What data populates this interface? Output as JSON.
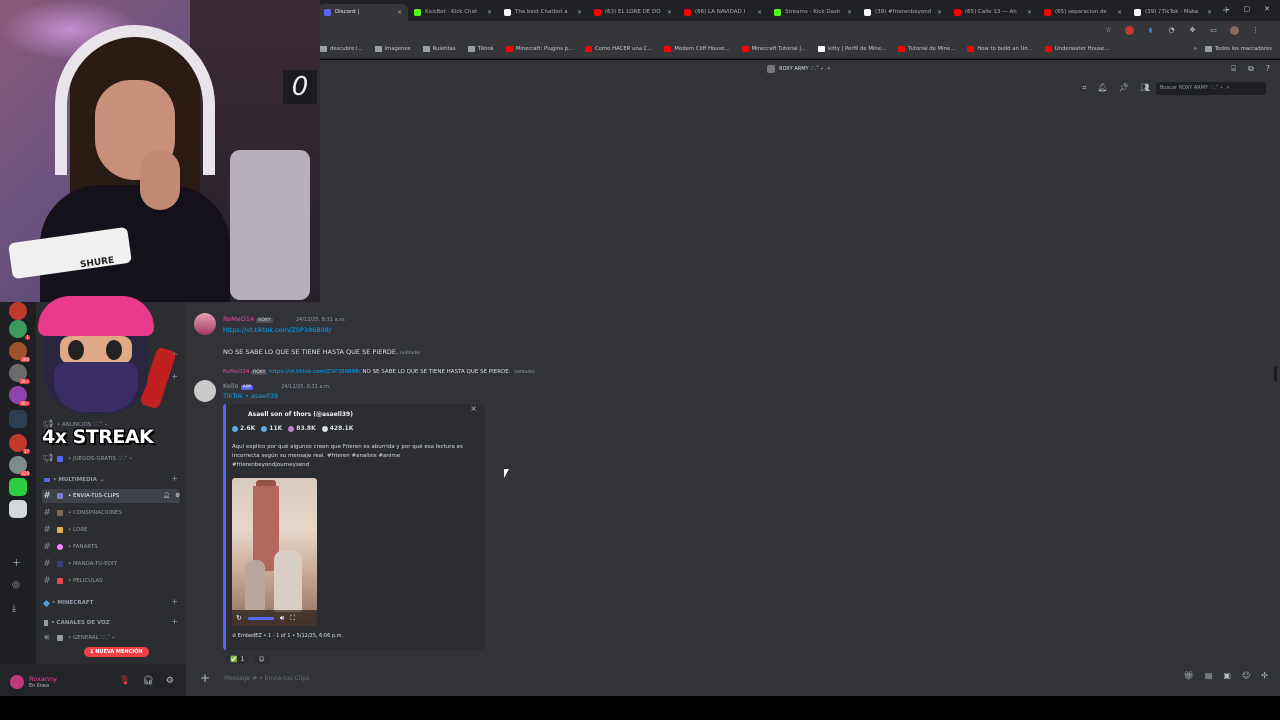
{
  "browser": {
    "tabs": [
      {
        "title": "Discord |",
        "color": "#5865f2"
      },
      {
        "title": "KickBot - Kick Chat",
        "color": "#53fc18"
      },
      {
        "title": "The best Chatbot a",
        "color": "#ffffff"
      },
      {
        "title": "(63) EL LORE DE DO",
        "color": "#ff0000"
      },
      {
        "title": "(66) LA NAVIDAD I",
        "color": "#ff0000"
      },
      {
        "title": "Streams - Kick Dash",
        "color": "#53fc18"
      },
      {
        "title": "(39) #frierenbeyond",
        "color": "#ffffff"
      },
      {
        "title": "(65) Calle 13 — Ah",
        "color": "#ff0000"
      },
      {
        "title": "(65) separacion de",
        "color": "#ff0000"
      },
      {
        "title": "(39) ♪TikTok - Make",
        "color": "#ffffff"
      }
    ],
    "bookmarks": [
      {
        "label": "descubre l...",
        "color": "#9aa0a6"
      },
      {
        "label": "Imagenes",
        "color": "#9aa0a6"
      },
      {
        "label": "Ruletitas",
        "color": "#9aa0a6"
      },
      {
        "label": "Tiktok",
        "color": "#9aa0a6"
      },
      {
        "label": "Minecraft: Plugins p...",
        "color": "#ff0000"
      },
      {
        "label": "Como HACER una C...",
        "color": "#ff0000"
      },
      {
        "label": "Modern Cliff House...",
        "color": "#ff0000"
      },
      {
        "label": "Minecraft Tutorial |...",
        "color": "#ff0000"
      },
      {
        "label": "kitty | Perfil de Mine...",
        "color": "#ffffff"
      },
      {
        "label": "Tutorial de Mine...",
        "color": "#ff0000"
      },
      {
        "label": "How to build an Un...",
        "color": "#ff0000"
      },
      {
        "label": "Underwater House...",
        "color": "#ff0000"
      }
    ],
    "all_bookmarks_label": "Todos los marcadores"
  },
  "discord": {
    "server_title": "ROXY ARMY ♡.˚ ⋆ .✧",
    "search_placeholder": "Buscar ROXY ARMY ♡.˚ ⋆ .✧",
    "categories": {
      "multimedia": "• MULTIMEDIA",
      "minecraft": "• MINECRAFT",
      "voz": "• CANALES DE VOZ"
    },
    "channels": [
      {
        "name": "• ANUNCIOS ♡.˚ ⋆",
        "active": false
      },
      {
        "name": "• JUEGOS-GRATIS ♡.˚ ⋆",
        "active": false
      },
      {
        "name": "• ENVIA-TUS-CLIPS",
        "active": true
      },
      {
        "name": "• CONSPIRACIONES",
        "active": false
      },
      {
        "name": "• LORE",
        "active": false
      },
      {
        "name": "• FANARTS",
        "active": false
      },
      {
        "name": "• MANDA-TU-EDIT",
        "active": false
      },
      {
        "name": "• PELICULAS",
        "active": false
      }
    ],
    "voice_channels": [
      {
        "name": "• GENERAL ♡.˚ ⋆"
      }
    ],
    "mention_pill": "1 NUEVA MENCIÓN",
    "user": {
      "name": "Roxanny",
      "status": "En línea"
    },
    "messages": {
      "m1": {
        "author": "RoMeO14",
        "tag": "ROXY",
        "time": "24/12/25, 8:31 a.m.",
        "link": "https://vt.tiktok.com/ZSP386B98/",
        "text": "NO SE SABE LO QUE SE TIENE HASTA QUE SE PIERDE.",
        "edited": "(editado)"
      },
      "m2": {
        "reply_author": "RoMeO14",
        "reply_tag": "ROXY",
        "reply_link": "https://vt.tiktok.com/ZSP386B98/",
        "reply_text": "NO SE SABE LO QUE SE TIENE HASTA QUE SE PIERDE.",
        "reply_edited": "(editado)",
        "author": "Kello",
        "app_tag": "APP",
        "time": "24/12/25, 8:31 a.m.",
        "provider": "TikTok • asaell39"
      }
    },
    "embed": {
      "title": "Asaell son of thors (@asaell39)",
      "stats": [
        {
          "value": "2.6K",
          "color": "#5dade2"
        },
        {
          "value": "11K",
          "color": "#5dade2"
        },
        {
          "value": "83.8K",
          "color": "#c27fd9"
        },
        {
          "value": "428.1K",
          "color": "#dbdee1"
        }
      ],
      "description": "Aquí explico por qué algunos creen que Frieren es aburrida y por qué esa lectura es incorrecta según su mensaje real. #frieren #analisis #anime #frierenbeyondjourneysend",
      "footer": "EmbedEZ • 1 - 1 of 1 • 5/12/25, 6:06 p.m."
    },
    "reactions": [
      {
        "emoji": "✅",
        "count": "1"
      }
    ],
    "composer_placeholder": "Message # • Envia-tus-Clips"
  },
  "overlay": {
    "streak_text": "4x STREAK",
    "clock_digit": "0",
    "mic_brand": "SHURE"
  },
  "server_badges": [
    "1",
    "360",
    "2K+",
    "4K+",
    "37",
    "429"
  ]
}
